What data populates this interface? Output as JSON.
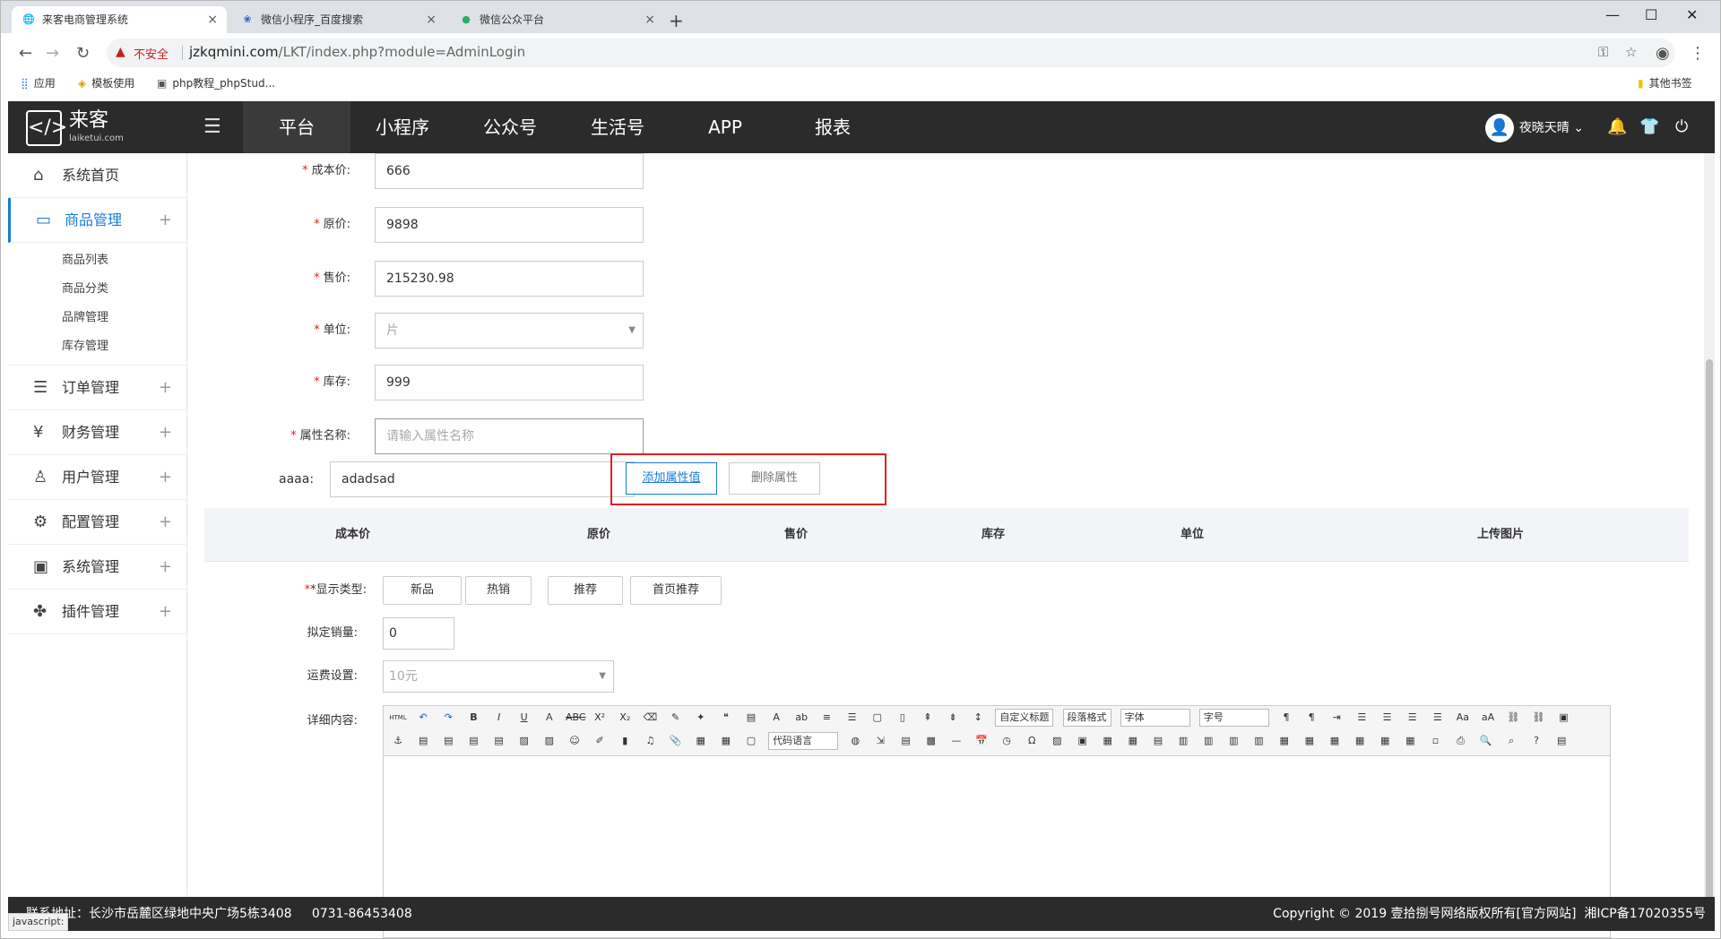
{
  "browser": {
    "tabs": [
      {
        "title": "来客电商管理系统",
        "icon": "globe-icon"
      },
      {
        "title": "微信小程序_百度搜索",
        "icon": "baidu-paw-icon"
      },
      {
        "title": "微信公众平台",
        "icon": "wechat-icon"
      }
    ],
    "not_secure": "不安全",
    "url_domain": "jzkqmini.com",
    "url_path": "/LKT/index.php?module=AdminLogin",
    "bookmarks": [
      {
        "label": "应用",
        "icon": "apps-grid-icon"
      },
      {
        "label": "模板使用",
        "icon": "bookmark-icon"
      },
      {
        "label": "php教程_phpStud...",
        "icon": "bookmark-icon"
      }
    ],
    "other_bookmarks": "其他书签"
  },
  "header": {
    "logo_name": "来客",
    "logo_domain": "laiketui.com",
    "nav_tabs": [
      "平台",
      "小程序",
      "公众号",
      "生活号",
      "APP",
      "报表"
    ],
    "active_tab": "平台",
    "username": "夜晓天晴"
  },
  "sidebar": {
    "items": [
      {
        "label": "系统首页",
        "icon": "home-icon"
      },
      {
        "label": "商品管理",
        "icon": "briefcase-icon",
        "active": true,
        "children": [
          "商品列表",
          "商品分类",
          "品牌管理",
          "库存管理"
        ]
      },
      {
        "label": "订单管理",
        "icon": "order-icon"
      },
      {
        "label": "财务管理",
        "icon": "finance-icon"
      },
      {
        "label": "用户管理",
        "icon": "user-icon"
      },
      {
        "label": "配置管理",
        "icon": "config-icon"
      },
      {
        "label": "系统管理",
        "icon": "monitor-icon"
      },
      {
        "label": "插件管理",
        "icon": "plugin-icon"
      }
    ]
  },
  "form": {
    "cost_price": {
      "label": "成本价:",
      "value": "666"
    },
    "original_price": {
      "label": "原价:",
      "value": "9898"
    },
    "sale_price": {
      "label": "售价:",
      "value": "215230.98"
    },
    "unit": {
      "label": "单位:",
      "value": "片"
    },
    "stock": {
      "label": "库存:",
      "value": "999"
    },
    "attr_name": {
      "label": "属性名称:",
      "placeholder": "请输入属性名称"
    },
    "attr_row": {
      "label": "aaaa:",
      "value": "adadsad"
    },
    "add_attr_value": "添加属性值",
    "delete_attr": "删除属性",
    "table_headers": [
      "成本价",
      "原价",
      "售价",
      "库存",
      "单位",
      "上传图片"
    ],
    "display_type": {
      "label": "*显示类型:",
      "options": [
        "新品",
        "热销",
        "推荐",
        "首页推荐"
      ]
    },
    "planned_sales": {
      "label": "拟定销量:",
      "value": "0"
    },
    "shipping": {
      "label": "运费设置:",
      "value": "10元"
    },
    "details": {
      "label": "详细内容:"
    },
    "editor_selects": [
      "自定义标题",
      "段落格式",
      "字体",
      "字号",
      "代码语言"
    ]
  },
  "footer": {
    "address": "联系地址：长沙市岳麓区绿地中央广场5栋3408",
    "phone": "0731-86453408",
    "copyright": "Copyright © 2019 壹拾捌号网络版权所有[官方网站]",
    "icp": "湘ICP备17020355号"
  },
  "statusbar": "javascript:"
}
